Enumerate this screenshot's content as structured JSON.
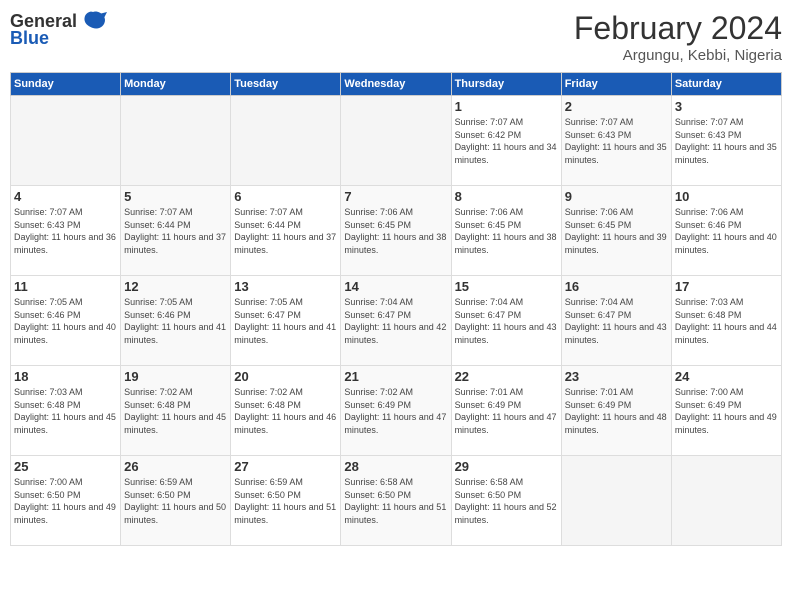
{
  "header": {
    "logo": {
      "general": "General",
      "blue": "Blue"
    },
    "title": "February 2024",
    "subtitle": "Argungu, Kebbi, Nigeria"
  },
  "days_of_week": [
    "Sunday",
    "Monday",
    "Tuesday",
    "Wednesday",
    "Thursday",
    "Friday",
    "Saturday"
  ],
  "weeks": [
    [
      {
        "day": "",
        "info": ""
      },
      {
        "day": "",
        "info": ""
      },
      {
        "day": "",
        "info": ""
      },
      {
        "day": "",
        "info": ""
      },
      {
        "day": "1",
        "info": "Sunrise: 7:07 AM\nSunset: 6:42 PM\nDaylight: 11 hours and 34 minutes."
      },
      {
        "day": "2",
        "info": "Sunrise: 7:07 AM\nSunset: 6:43 PM\nDaylight: 11 hours and 35 minutes."
      },
      {
        "day": "3",
        "info": "Sunrise: 7:07 AM\nSunset: 6:43 PM\nDaylight: 11 hours and 35 minutes."
      }
    ],
    [
      {
        "day": "4",
        "info": "Sunrise: 7:07 AM\nSunset: 6:43 PM\nDaylight: 11 hours and 36 minutes."
      },
      {
        "day": "5",
        "info": "Sunrise: 7:07 AM\nSunset: 6:44 PM\nDaylight: 11 hours and 37 minutes."
      },
      {
        "day": "6",
        "info": "Sunrise: 7:07 AM\nSunset: 6:44 PM\nDaylight: 11 hours and 37 minutes."
      },
      {
        "day": "7",
        "info": "Sunrise: 7:06 AM\nSunset: 6:45 PM\nDaylight: 11 hours and 38 minutes."
      },
      {
        "day": "8",
        "info": "Sunrise: 7:06 AM\nSunset: 6:45 PM\nDaylight: 11 hours and 38 minutes."
      },
      {
        "day": "9",
        "info": "Sunrise: 7:06 AM\nSunset: 6:45 PM\nDaylight: 11 hours and 39 minutes."
      },
      {
        "day": "10",
        "info": "Sunrise: 7:06 AM\nSunset: 6:46 PM\nDaylight: 11 hours and 40 minutes."
      }
    ],
    [
      {
        "day": "11",
        "info": "Sunrise: 7:05 AM\nSunset: 6:46 PM\nDaylight: 11 hours and 40 minutes."
      },
      {
        "day": "12",
        "info": "Sunrise: 7:05 AM\nSunset: 6:46 PM\nDaylight: 11 hours and 41 minutes."
      },
      {
        "day": "13",
        "info": "Sunrise: 7:05 AM\nSunset: 6:47 PM\nDaylight: 11 hours and 41 minutes."
      },
      {
        "day": "14",
        "info": "Sunrise: 7:04 AM\nSunset: 6:47 PM\nDaylight: 11 hours and 42 minutes."
      },
      {
        "day": "15",
        "info": "Sunrise: 7:04 AM\nSunset: 6:47 PM\nDaylight: 11 hours and 43 minutes."
      },
      {
        "day": "16",
        "info": "Sunrise: 7:04 AM\nSunset: 6:47 PM\nDaylight: 11 hours and 43 minutes."
      },
      {
        "day": "17",
        "info": "Sunrise: 7:03 AM\nSunset: 6:48 PM\nDaylight: 11 hours and 44 minutes."
      }
    ],
    [
      {
        "day": "18",
        "info": "Sunrise: 7:03 AM\nSunset: 6:48 PM\nDaylight: 11 hours and 45 minutes."
      },
      {
        "day": "19",
        "info": "Sunrise: 7:02 AM\nSunset: 6:48 PM\nDaylight: 11 hours and 45 minutes."
      },
      {
        "day": "20",
        "info": "Sunrise: 7:02 AM\nSunset: 6:48 PM\nDaylight: 11 hours and 46 minutes."
      },
      {
        "day": "21",
        "info": "Sunrise: 7:02 AM\nSunset: 6:49 PM\nDaylight: 11 hours and 47 minutes."
      },
      {
        "day": "22",
        "info": "Sunrise: 7:01 AM\nSunset: 6:49 PM\nDaylight: 11 hours and 47 minutes."
      },
      {
        "day": "23",
        "info": "Sunrise: 7:01 AM\nSunset: 6:49 PM\nDaylight: 11 hours and 48 minutes."
      },
      {
        "day": "24",
        "info": "Sunrise: 7:00 AM\nSunset: 6:49 PM\nDaylight: 11 hours and 49 minutes."
      }
    ],
    [
      {
        "day": "25",
        "info": "Sunrise: 7:00 AM\nSunset: 6:50 PM\nDaylight: 11 hours and 49 minutes."
      },
      {
        "day": "26",
        "info": "Sunrise: 6:59 AM\nSunset: 6:50 PM\nDaylight: 11 hours and 50 minutes."
      },
      {
        "day": "27",
        "info": "Sunrise: 6:59 AM\nSunset: 6:50 PM\nDaylight: 11 hours and 51 minutes."
      },
      {
        "day": "28",
        "info": "Sunrise: 6:58 AM\nSunset: 6:50 PM\nDaylight: 11 hours and 51 minutes."
      },
      {
        "day": "29",
        "info": "Sunrise: 6:58 AM\nSunset: 6:50 PM\nDaylight: 11 hours and 52 minutes."
      },
      {
        "day": "",
        "info": ""
      },
      {
        "day": "",
        "info": ""
      }
    ]
  ]
}
